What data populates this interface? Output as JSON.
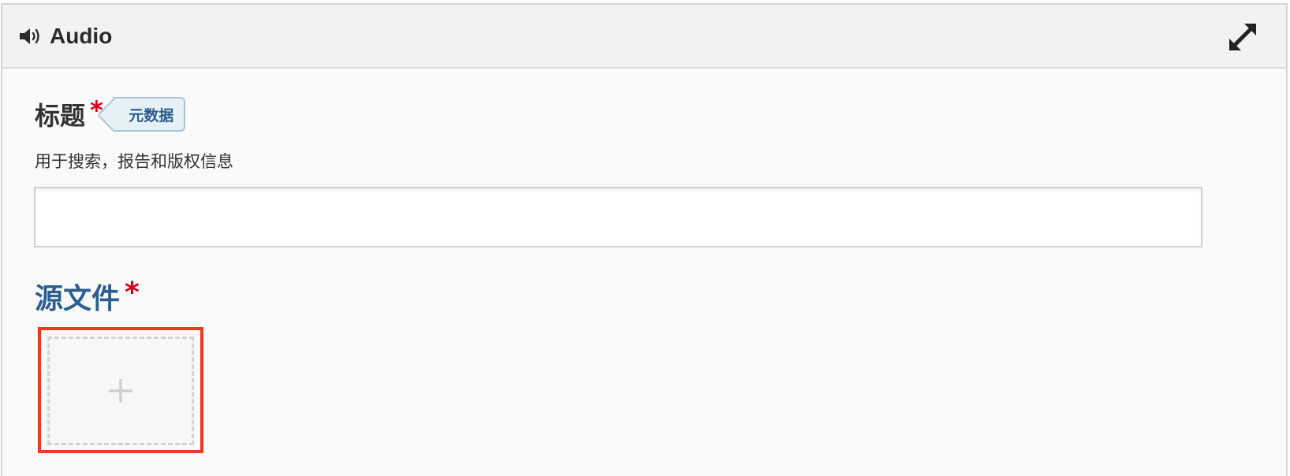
{
  "panel": {
    "title": "Audio",
    "header_icon": "speaker-volume-icon",
    "expand_icon": "expand-arrows-icon"
  },
  "title_field": {
    "label": "标题",
    "required_marker": "*",
    "tag": "元数据",
    "description": "用于搜索，报告和版权信息",
    "value": "",
    "placeholder": ""
  },
  "source_field": {
    "label": "源文件",
    "required_marker": "*",
    "add_icon": "plus-icon"
  },
  "colors": {
    "required": "#d0021b",
    "source_label": "#2c5f8f",
    "highlight": "#ec3b22",
    "tag_bg": "#e6f0f7"
  }
}
